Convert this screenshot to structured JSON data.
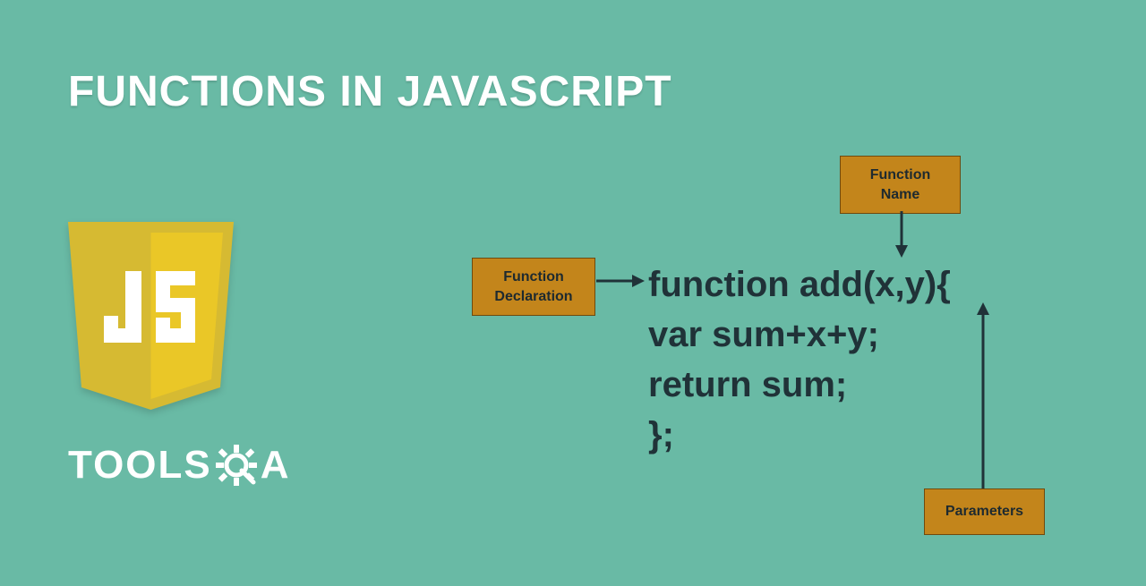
{
  "title": "FUNCTIONS IN JAVASCRIPT",
  "logo": {
    "js_text": "JS"
  },
  "brand": {
    "part1": "TOOLS",
    "part2": "A",
    "gear_icon": "gear-icon"
  },
  "code": {
    "line1": "function add(x,y){",
    "line2": "var sum+x+y;",
    "line3": "return sum;",
    "line4": "};"
  },
  "callouts": {
    "declaration": "Function\nDeclaration",
    "name": "Function\nName",
    "parameters": "Parameters"
  }
}
